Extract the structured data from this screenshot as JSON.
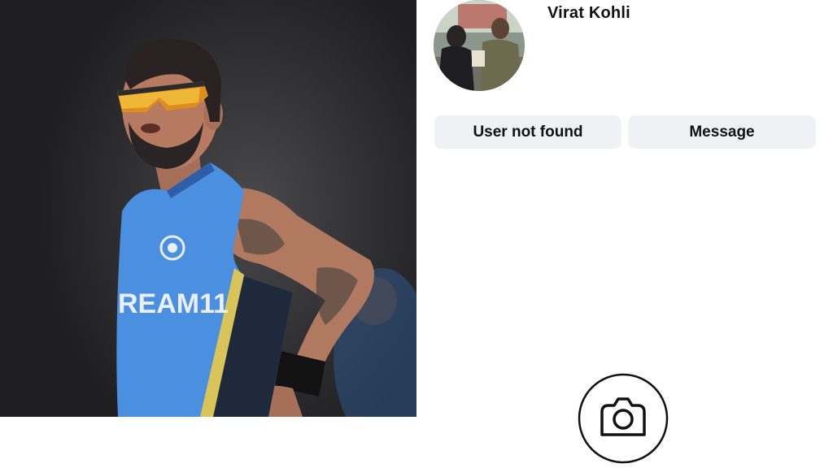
{
  "profile": {
    "username": "Virat Kohli",
    "primary_button": "User not found",
    "secondary_button": "Message"
  },
  "photo": {
    "jersey_text": "REAM11"
  },
  "icons": {
    "avatar": "avatar-photo",
    "camera": "camera-icon"
  },
  "colors": {
    "jersey_blue": "#4a8fe0",
    "accent_yellow": "#d9c45a",
    "button_bg": "#eff1f4"
  }
}
